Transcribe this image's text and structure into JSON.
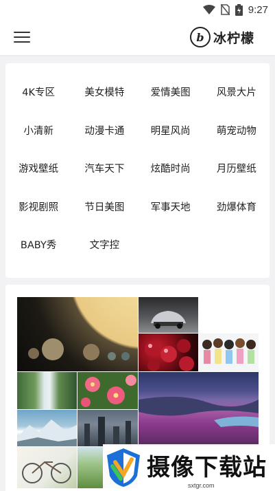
{
  "status_bar": {
    "time": "9:27",
    "icons": [
      "wifi-icon",
      "no-sim-icon",
      "battery-charging-icon"
    ]
  },
  "app_bar": {
    "menu_icon": "hamburger-menu-icon",
    "logo_glyph": "b",
    "app_name": "冰柠檬"
  },
  "categories": [
    "4K专区",
    "美女模特",
    "爱情美图",
    "风景大片",
    "小清新",
    "动漫卡通",
    "明星风尚",
    "萌宠动物",
    "游戏壁纸",
    "汽车天下",
    "炫酷时尚",
    "月历壁纸",
    "影视剧照",
    "节日美图",
    "军事天地",
    "劲爆体育",
    "BABY秀",
    "文字控"
  ],
  "gallery": {
    "tiles": [
      "planets-image",
      "sports-car-image",
      "cherries-image",
      "anime-girls-image",
      "waterfall-image",
      "pink-flowers-image",
      "purple-flower-field-image",
      "snow-mountain-image",
      "sci-fi-city-image",
      "bicycle-image",
      "green-hills-image"
    ]
  },
  "watermark": {
    "text": "摄像下载站",
    "url": "sxtgr.com"
  }
}
